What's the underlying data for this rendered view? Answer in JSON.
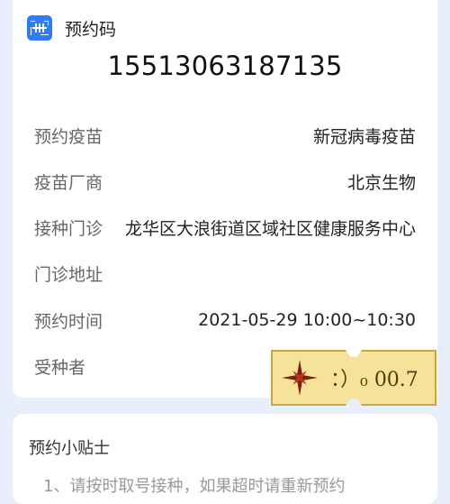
{
  "header": {
    "title": "预约码"
  },
  "code": "15513063187135",
  "details": [
    {
      "label": "预约疫苗",
      "value": "新冠病毒疫苗"
    },
    {
      "label": "疫苗厂商",
      "value": "北京生物"
    },
    {
      "label": "接种门诊",
      "value": "龙华区大浪街道区域社区健康服务中心"
    },
    {
      "label": "门诊地址",
      "value": ""
    },
    {
      "label": "预约时间",
      "value": "2021-05-29 10:00~10:30"
    },
    {
      "label": "受种者",
      "value": ""
    }
  ],
  "sticker": {
    "text": "：）₀ 00.7",
    "icon": "sparkle-star-icon"
  },
  "tips": {
    "title": "预约小贴士",
    "line1": "1、请按时取号接种，如果超时请重新预约"
  },
  "colors": {
    "accent": "#2f7cf6",
    "background": "#e8eefb",
    "sticker": "#f6e39a"
  }
}
